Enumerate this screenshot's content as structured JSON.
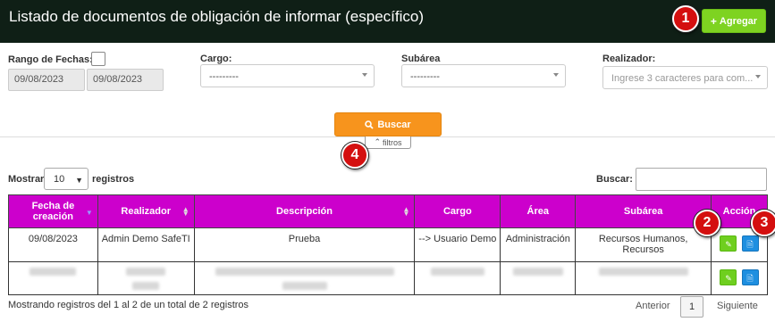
{
  "header": {
    "title": "Listado de documentos de obligación de informar (específico)",
    "add_button": "Agregar"
  },
  "annotations": [
    "1",
    "2",
    "3",
    "4"
  ],
  "filters": {
    "date_range_label": "Rango de Fechas:",
    "date_from": "09/08/2023",
    "date_to": "09/08/2023",
    "cargo_label": "Cargo:",
    "cargo_value": "---------",
    "subarea_label": "Subárea",
    "subarea_value": "---------",
    "realizador_label": "Realizador:",
    "realizador_placeholder": "Ingrese 3 caracteres para com...",
    "search_button": "Buscar",
    "toggle_label": "filtros"
  },
  "table_controls": {
    "show_label": "Mostrar",
    "page_length": "10",
    "records_label": "registros",
    "search_label": "Buscar:"
  },
  "table": {
    "headers": [
      "Fecha de creación",
      "Realizador",
      "Descripción",
      "Cargo",
      "Área",
      "Subárea",
      "Acción"
    ],
    "rows": [
      {
        "fecha": "09/08/2023",
        "realizador": "Admin Demo SafeTI",
        "descripcion": "Prueba",
        "cargo": "--> Usuario Demo",
        "area": "Administración",
        "subarea": "Recursos Humanos, Recursos"
      }
    ]
  },
  "footer": {
    "info": "Mostrando registros del 1 al 2 de un total de 2 registros",
    "prev": "Anterior",
    "page": "1",
    "next": "Siguiente"
  }
}
